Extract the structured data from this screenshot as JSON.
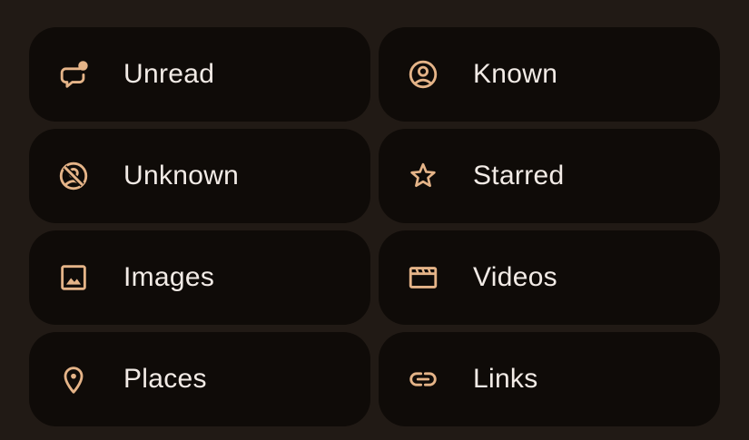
{
  "theme": {
    "background": "#211a15",
    "chip_background": "#0f0b08",
    "icon_color": "#e5b488",
    "label_color": "#f2ebe6"
  },
  "filters": [
    {
      "label": "Unread",
      "icon": "unread-chat-icon"
    },
    {
      "label": "Known",
      "icon": "account-circle-icon"
    },
    {
      "label": "Unknown",
      "icon": "unknown-contact-icon"
    },
    {
      "label": "Starred",
      "icon": "star-icon"
    },
    {
      "label": "Images",
      "icon": "image-icon"
    },
    {
      "label": "Videos",
      "icon": "video-clapper-icon"
    },
    {
      "label": "Places",
      "icon": "location-pin-icon"
    },
    {
      "label": "Links",
      "icon": "link-icon"
    }
  ]
}
